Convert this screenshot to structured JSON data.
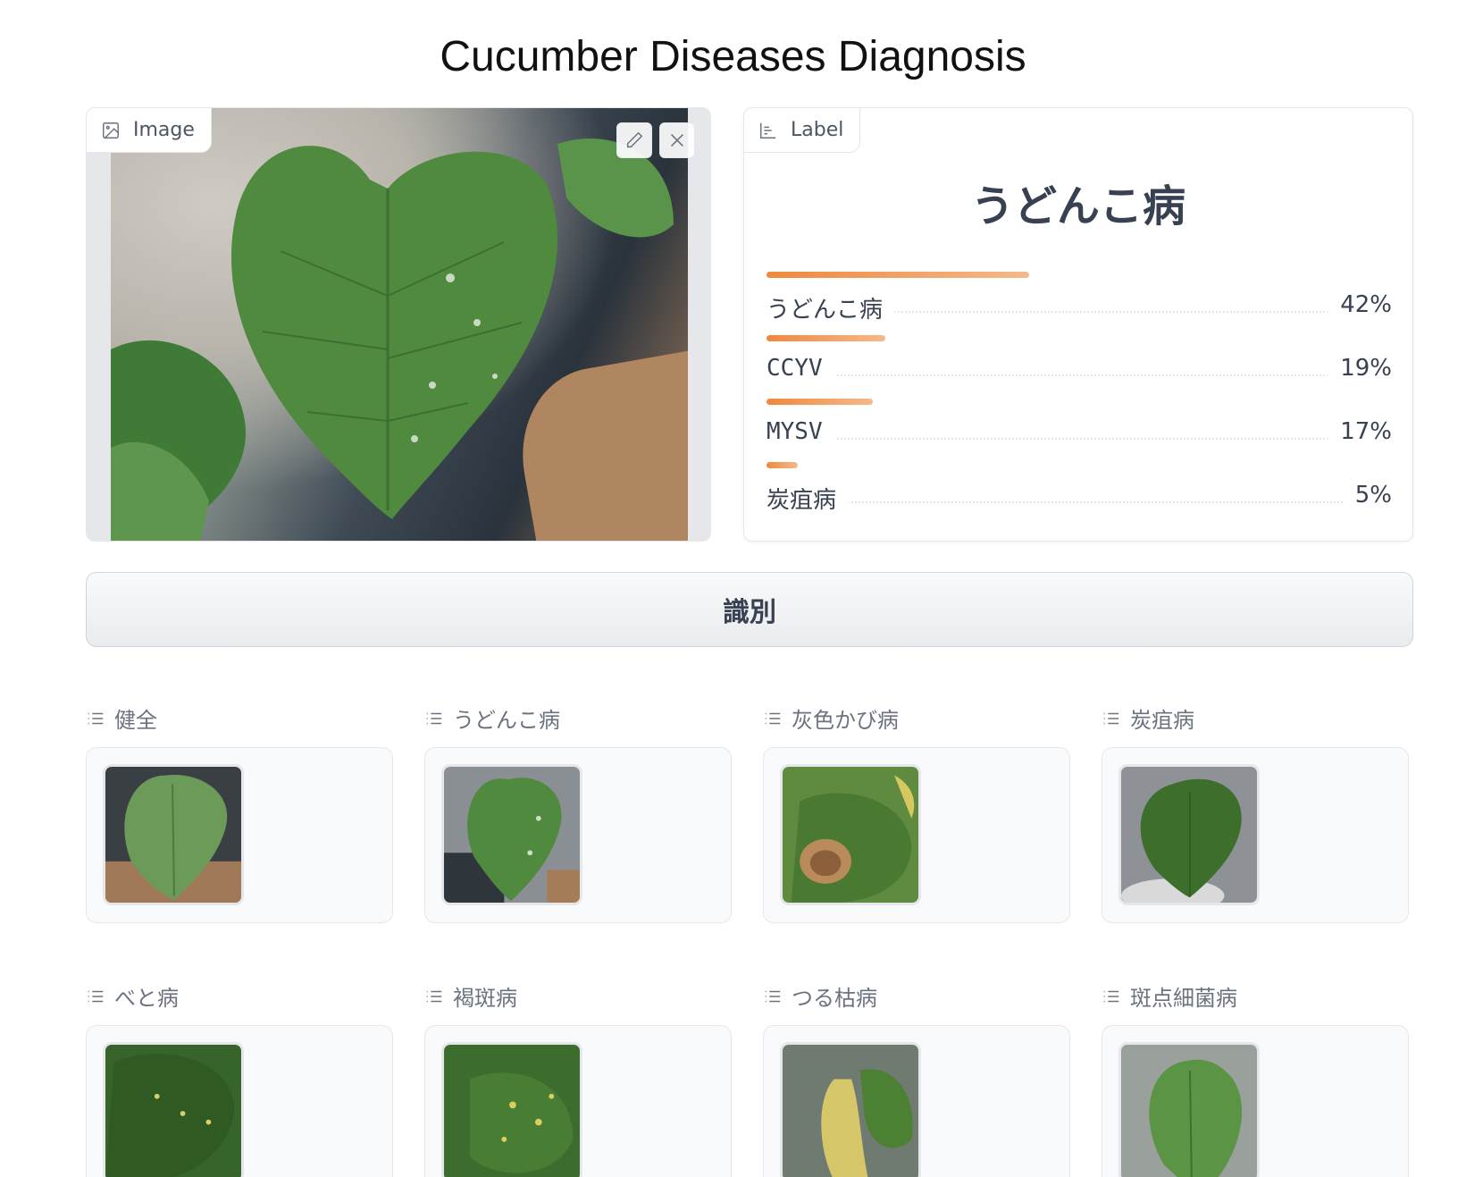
{
  "app": {
    "title": "Cucumber Diseases Diagnosis"
  },
  "input_panel": {
    "tag_label": "Image",
    "tag_icon": "image-icon",
    "edit_icon": "pencil-icon",
    "clear_icon": "close-icon"
  },
  "output_panel": {
    "tag_label": "Label",
    "tag_icon": "bar-chart-icon",
    "top_label": "うどんこ病",
    "confidences": [
      {
        "name": "うどんこ病",
        "percent": "42%",
        "value": 0.42
      },
      {
        "name": "CCYV",
        "percent": "19%",
        "value": 0.19
      },
      {
        "name": "MYSV",
        "percent": "17%",
        "value": 0.17
      },
      {
        "name": "炭疽病",
        "percent": "5%",
        "value": 0.05
      }
    ]
  },
  "submit_button": {
    "label": "識別"
  },
  "examples": [
    {
      "label": "健全",
      "icon": "list-icon"
    },
    {
      "label": "うどんこ病",
      "icon": "list-icon"
    },
    {
      "label": "灰色かび病",
      "icon": "list-icon"
    },
    {
      "label": "炭疽病",
      "icon": "list-icon"
    },
    {
      "label": "べと病",
      "icon": "list-icon"
    },
    {
      "label": "褐斑病",
      "icon": "list-icon"
    },
    {
      "label": "つる枯病",
      "icon": "list-icon"
    },
    {
      "label": "斑点細菌病",
      "icon": "list-icon"
    }
  ],
  "colors": {
    "accent_start": "#f0883e",
    "accent_end": "#f5b98a",
    "leaf_green": "#4f8a3e",
    "border": "#e5e7eb"
  }
}
